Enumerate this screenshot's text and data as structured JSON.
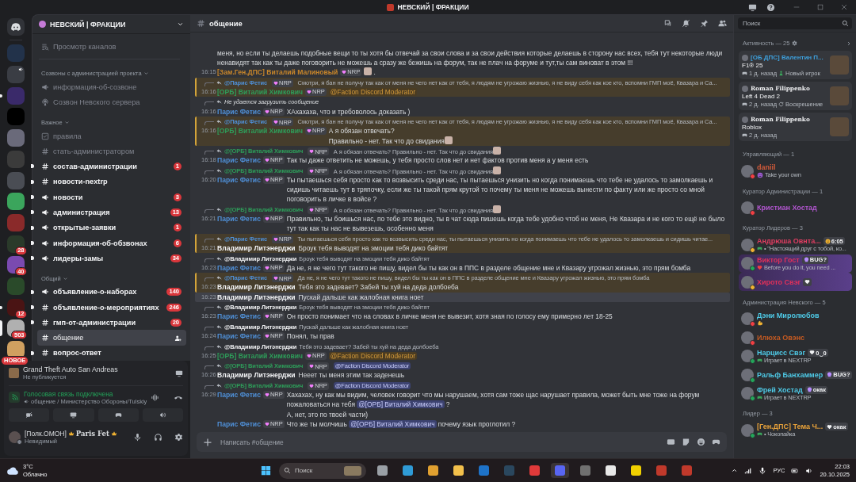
{
  "window": {
    "title": "НЕВСКИЙ | ФРАКЦИИ"
  },
  "servers": [
    {
      "selected": false,
      "unread": false,
      "in_voice": false
    },
    {
      "selected": false,
      "unread": false,
      "in_voice": true
    },
    {
      "selected": false,
      "unread": true,
      "in_voice": false
    },
    {
      "selected": false,
      "unread": false,
      "in_voice": false
    },
    {
      "selected": false,
      "unread": false,
      "in_voice": false
    },
    {
      "selected": false,
      "unread": false,
      "in_voice": false
    },
    {
      "selected": false,
      "unread": false,
      "in_voice": false
    },
    {
      "selected": false,
      "unread": false,
      "in_voice": false
    },
    {
      "selected": false,
      "unread": false,
      "in_voice": false
    },
    {
      "selected": false,
      "unread": false,
      "in_voice": false,
      "badge": "28"
    },
    {
      "selected": false,
      "unread": false,
      "in_voice": false,
      "badge": "40"
    },
    {
      "selected": false,
      "unread": false,
      "in_voice": false
    },
    {
      "selected": false,
      "unread": true,
      "in_voice": false,
      "badge": "12"
    },
    {
      "selected": true,
      "unread": false,
      "in_voice": false,
      "badge": "503"
    },
    {
      "selected": false,
      "unread": false,
      "in_voice": false,
      "badge": "НОВОЕ"
    }
  ],
  "guild": {
    "name": "НЕВСКИЙ | ФРАКЦИИ",
    "browse_label": "Просмотр каналов",
    "categories": [
      {
        "name": "Созвоны с администрацией проекта",
        "channels": [
          {
            "name": "информация-об-созвоне",
            "kind": "announcement",
            "unread": false,
            "selected": false
          },
          {
            "name": "Созвон Невского сервера",
            "kind": "stage",
            "unread": false,
            "selected": false
          }
        ]
      },
      {
        "name": "Важное",
        "channels": [
          {
            "name": "правила",
            "kind": "rules",
            "unread": false,
            "selected": false
          },
          {
            "name": "стать-администратором",
            "kind": "text",
            "unread": false,
            "selected": false
          },
          {
            "name": "состав-администрации",
            "kind": "text",
            "unread": true,
            "selected": false,
            "badge": "1"
          },
          {
            "name": "новости-nextrp",
            "kind": "text",
            "unread": true,
            "selected": false
          },
          {
            "name": "новости",
            "kind": "announcement",
            "unread": true,
            "selected": false,
            "badge": "3"
          },
          {
            "name": "администрация",
            "kind": "announcement",
            "unread": true,
            "selected": false,
            "badge": "13"
          },
          {
            "name": "открытые-заявки",
            "kind": "announcement",
            "unread": true,
            "selected": false,
            "badge": "1"
          },
          {
            "name": "информация-об-обзвонах",
            "kind": "announcement",
            "unread": true,
            "selected": false,
            "badge": "6"
          },
          {
            "name": "лидеры-замы",
            "kind": "announcement",
            "unread": true,
            "selected": false,
            "badge": "34"
          }
        ]
      },
      {
        "name": "Общий",
        "channels": [
          {
            "name": "объявление-о-наборах",
            "kind": "announcement",
            "unread": true,
            "selected": false,
            "badge": "140"
          },
          {
            "name": "объявление-о-мероприятиях",
            "kind": "text",
            "unread": true,
            "selected": false,
            "badge": "246"
          },
          {
            "name": "гмп-от-администрации",
            "kind": "text",
            "unread": true,
            "selected": false,
            "badge": "20"
          },
          {
            "name": "общение",
            "kind": "text",
            "unread": false,
            "selected": true
          },
          {
            "name": "вопрос-ответ",
            "kind": "text",
            "unread": true,
            "selected": false
          }
        ]
      }
    ]
  },
  "user_panel": {
    "activity": {
      "game": "Grand Theft Auto San Andreas",
      "status": "Не публикуется"
    },
    "voice": {
      "title": "Голосовая связь подключена",
      "channel": "общение / Министерство Обороны/Tulskiy"
    },
    "user": {
      "prefix": "[Полк.ОМОН]",
      "name": "Paris Fet",
      "status_text": "Невидимый",
      "status": {
        "color": "#80848e"
      }
    }
  },
  "chat": {
    "channel": "общение",
    "placeholder": "Написать #общение",
    "messages": [
      {
        "mentioned": false,
        "hovered": false,
        "content": [
          {
            "kind": "text",
            "text": "меня, но если ты делаешь подобные вещи то ты хотя бы отвечай за свои слова и за свои действия которые делаешь в сторону нас всех, тебя тут некоторые люди ненавидят так как ты даже поговорить не можешь а сразу же бежишь на форум, так не плач на форуме и тут,ты сам виноват в этом !!!"
          }
        ]
      },
      {
        "mentioned": false,
        "hovered": false,
        "time": "16:15",
        "author": "[Зам.Ген.ДПС] Виталий Малиновый",
        "color": "#c8862a",
        "badge": "NRP",
        "content": [
          {
            "kind": "emoji"
          },
          {
            "kind": "text",
            "text": " ."
          }
        ]
      },
      {
        "mentioned": true,
        "hovered": false,
        "reply": {
          "kind": "message",
          "author": "@Парис Фетис",
          "color": "#4f8fd6",
          "badge": "NRP",
          "content": [
            {
              "kind": "text",
              "text": "Смотри, я бан не получу так как от меня не чего нет как от тебя, я людям не угрожаю жизнью, я не виду себя как кое кто, вспомни ГМП моё, Квазара и Са..."
            }
          ]
        },
        "time": "16:16",
        "author": "[ОРБ] Виталий Химкович",
        "color": "#2e9e5a",
        "badge": "NRP",
        "content": [
          {
            "kind": "role_mention",
            "text": "@Faction Discord Moderator"
          }
        ]
      },
      {
        "mentioned": false,
        "hovered": false,
        "reply": {
          "kind": "missing",
          "content": [
            {
              "kind": "text",
              "text": "Не удается загрузить сообщение"
            }
          ]
        },
        "time": "16:16",
        "author": "Парис Фетис",
        "color": "#4f8fd6",
        "badge": "NRP",
        "content": [
          {
            "kind": "text",
            "text": "ХАхахаха, что и требоволось доказать )"
          }
        ]
      },
      {
        "mentioned": true,
        "hovered": false,
        "reply": {
          "kind": "message",
          "author": "@Парис Фетис",
          "color": "#4f8fd6",
          "badge": "NRP",
          "content": [
            {
              "kind": "text",
              "text": "Смотри, я бан не получу так как от меня не чего нет как от тебя, я людям не угрожаю жизнью, я не виду себя как кое кто, вспомни ГМП моё, Квазара и Са..."
            }
          ]
        },
        "time": "16:16",
        "author": "[ОРБ] Виталий Химкович",
        "color": "#2e9e5a",
        "badge": "NRP",
        "content": [
          {
            "kind": "text",
            "text": "А я обязан отвечать?"
          },
          {
            "kind": "break"
          },
          {
            "kind": "text",
            "text": "Правильно - нет. Так что до свидания"
          },
          {
            "kind": "emoji"
          }
        ]
      },
      {
        "mentioned": false,
        "hovered": false,
        "reply": {
          "kind": "message",
          "author": "@[ОРБ] Виталий Химкович",
          "color": "#2e9e5a",
          "badge": "NRP",
          "content": [
            {
              "kind": "text",
              "text": "А я обязан отвечать? Правильно - нет. Так что до свидания"
            },
            {
              "kind": "emoji"
            }
          ]
        },
        "time": "16:18",
        "author": "Парис Фетис",
        "color": "#4f8fd6",
        "badge": "NRP",
        "content": [
          {
            "kind": "text",
            "text": "Так ты даже ответить не можешь, у тебя просто слов нет и нет фактов против меня а у меня есть"
          }
        ]
      },
      {
        "mentioned": false,
        "hovered": false,
        "reply": {
          "kind": "message",
          "author": "@[ОРБ] Виталий Химкович",
          "color": "#2e9e5a",
          "badge": "NRP",
          "content": [
            {
              "kind": "text",
              "text": "А я обязан отвечать? Правильно - нет. Так что до свидания"
            },
            {
              "kind": "emoji"
            }
          ]
        },
        "time": "16:20",
        "author": "Парис Фетис",
        "color": "#4f8fd6",
        "badge": "NRP",
        "content": [
          {
            "kind": "text",
            "text": "Ты пытаешься себя просто как то возвысить среди нас, ты пытаешься унизить но когда понимаешь что тебе не удалось то замолкаешь и сидишь читаешь тут в тряпочку, если же ты такой прям крутой то почему ты меня не можешь вынести по факту или же просто со мной поговорить в личке в войсе ?"
          }
        ]
      },
      {
        "mentioned": false,
        "hovered": false,
        "reply": {
          "kind": "message",
          "author": "@[ОРБ] Виталий Химкович",
          "color": "#2e9e5a",
          "badge": "NRP",
          "content": [
            {
              "kind": "text",
              "text": "А я обязан отвечать? Правильно - нет. Так что до свидания"
            },
            {
              "kind": "emoji"
            }
          ]
        },
        "time": "16:21",
        "author": "Парис Фетис",
        "color": "#4f8fd6",
        "badge": "NRP",
        "content": [
          {
            "kind": "text",
            "text": "Правильно, ты боишься нас, по тебе это видно, ты в чат сюда пишешь когда тебе удобно чтоб не меня, Не Квазара и не кого то ещё не было тут так как ты нас не вывезешь, особенно меня"
          }
        ]
      },
      {
        "mentioned": true,
        "hovered": false,
        "reply": {
          "kind": "message",
          "author": "@Парис Фетис",
          "color": "#4f8fd6",
          "badge": "NRP",
          "content": [
            {
              "kind": "text",
              "text": "Ты пытаешься себя просто как то возвысить среди нас, ты пытаешься унизить но когда понимаешь что тебе не удалось то замолкаешь и сидишь читае..."
            }
          ]
        },
        "time": "16:21",
        "author": "Владимир Литэнерджи",
        "color": "#f2f3f5",
        "content": [
          {
            "kind": "text",
            "text": "Броук тебя выводят на эмоции тебя дико байтят"
          }
        ]
      },
      {
        "mentioned": false,
        "hovered": false,
        "reply": {
          "kind": "message",
          "author": "@Владимир Литэнерджи",
          "color": "#f2f3f5",
          "content": [
            {
              "kind": "text",
              "text": "Броук тебя выводят на эмоции тебя дико байтят"
            }
          ]
        },
        "time": "16:23",
        "author": "Парис Фетис",
        "color": "#4f8fd6",
        "badge": "NRP",
        "content": [
          {
            "kind": "text",
            "text": "Да не, я не чего тут такого не пишу, видел бы ты как он в ППС в разделе общение мне и Квазару угрожал жизнью, это прям бомба"
          }
        ]
      },
      {
        "mentioned": true,
        "hovered": false,
        "reply": {
          "kind": "message",
          "author": "@Парис Фетис",
          "color": "#4f8fd6",
          "badge": "NRP",
          "content": [
            {
              "kind": "text",
              "text": "Да не, я не чего тут такого не пишу, видел бы ты как он в ППС в разделе общение мне и Квазару угрожал жизнью, это прям бомба"
            }
          ]
        },
        "time": "16:23",
        "author": "Владимир Литэнерджи",
        "color": "#f2f3f5",
        "content": [
          {
            "kind": "text",
            "text": "Тебя это задевает? Забей ты хуй на деда долбоеба"
          }
        ]
      },
      {
        "mentioned": false,
        "hovered": true,
        "time": "16:23",
        "author": "Владимир Литэнерджи",
        "color": "#f2f3f5",
        "content": [
          {
            "kind": "text",
            "text": "Пускай дальше как жалобная книга ноет"
          }
        ]
      },
      {
        "mentioned": false,
        "hovered": false,
        "reply": {
          "kind": "message",
          "author": "@Владимир Литэнерджи",
          "color": "#f2f3f5",
          "content": [
            {
              "kind": "text",
              "text": "Броук тебя выводят на эмоции тебя дико байтят"
            }
          ]
        },
        "time": "16:23",
        "author": "Парис Фетис",
        "color": "#4f8fd6",
        "badge": "NRP",
        "content": [
          {
            "kind": "text",
            "text": "Он просто понимает что на словах в личке меня не вывезит, хотя зная по голосу ему примерно лет 18-25"
          }
        ]
      },
      {
        "mentioned": false,
        "hovered": false,
        "reply": {
          "kind": "message",
          "author": "@Владимир Литэнерджи",
          "color": "#f2f3f5",
          "content": [
            {
              "kind": "text",
              "text": "Пускай дальше как жалобная книга ноет"
            }
          ]
        },
        "time": "16:24",
        "author": "Парис Фетис",
        "color": "#4f8fd6",
        "badge": "NRP",
        "content": [
          {
            "kind": "text",
            "text": "Понял, ты прав"
          }
        ]
      },
      {
        "mentioned": false,
        "hovered": false,
        "reply": {
          "kind": "message",
          "author": "@Владимир Литэнерджи",
          "color": "#f2f3f5",
          "content": [
            {
              "kind": "text",
              "text": "Тебя это задевает? Забей ты хуй на деда долбоеба"
            }
          ]
        },
        "time": "16:25",
        "author": "[ОРБ] Виталий Химкович",
        "color": "#2e9e5a",
        "badge": "NRP",
        "content": [
          {
            "kind": "role_mention",
            "text": "@Faction Discord Moderator"
          }
        ]
      },
      {
        "mentioned": false,
        "hovered": false,
        "reply": {
          "kind": "message",
          "author": "@[ОРБ] Виталий Химкович",
          "color": "#2e9e5a",
          "badge": "NRP",
          "content": [
            {
              "kind": "mention",
              "text": "@Faction Discord Moderator"
            }
          ]
        },
        "time": "16:26",
        "author": "Владимир Литэнерджи",
        "color": "#f2f3f5",
        "content": [
          {
            "kind": "text",
            "text": "Нееет ты меня этим так заденешь"
          }
        ]
      },
      {
        "mentioned": false,
        "hovered": false,
        "reply": {
          "kind": "message",
          "author": "@[ОРБ] Виталий Химкович",
          "color": "#2e9e5a",
          "badge": "NRP",
          "content": [
            {
              "kind": "mention",
              "text": "@Faction Discord Moderator"
            }
          ]
        },
        "time": "16:29",
        "author": "Парис Фетис",
        "color": "#4f8fd6",
        "badge": "NRP",
        "content": [
          {
            "kind": "text",
            "text": "Хахахах, ну как мы видим, человек говорит что мы нарушаем, хотя сам тоже щас нарушает правила, может быть мне тоже на форум пожаловаться на тебя "
          },
          {
            "kind": "mention",
            "text": "@[ОРБ] Виталий Химкович"
          },
          {
            "kind": "text",
            "text": " ?"
          },
          {
            "kind": "break"
          },
          {
            "kind": "text",
            "text": "А, нет, это по твоей части)"
          }
        ]
      },
      {
        "mentioned": false,
        "hovered": false,
        "author": "Парис Фетис",
        "color": "#4f8fd6",
        "badge": "NRP",
        "content": [
          {
            "kind": "text",
            "text": "Что же ты молчишь "
          },
          {
            "kind": "mention",
            "text": "@[ОРБ] Виталий Химкович"
          },
          {
            "kind": "text",
            "text": " почему язык проглотил ?"
          }
        ]
      }
    ]
  },
  "member_list": {
    "search_placeholder": "Поиск",
    "activity": {
      "title": "Активность — 25",
      "cards": [
        {
          "user": "[ОБ ДПС] Валентин П...",
          "color": "#3ea0dc",
          "fancy": false,
          "game": "F1® 25",
          "ago": "1 д. назад",
          "detail": {
            "kind": "player",
            "text": "Новый игрок"
          }
        },
        {
          "user": "Roman Filippenko",
          "color": "#f2f3f5",
          "fancy": true,
          "game": "Left 4 Dead 2",
          "ago": "2 д. назад",
          "detail": {
            "kind": "refresh",
            "text": "Воскрешение"
          }
        },
        {
          "user": "Roman Filippenko",
          "color": "#f2f3f5",
          "fancy": true,
          "game": "Roblox",
          "ago": "2 д. назад"
        }
      ]
    },
    "groups": [
      {
        "title": "Управляющий — 1",
        "members": [
          {
            "name": "daniil",
            "color": "#d05a3a",
            "status": {
              "color": "#f23f43"
            },
            "banner": false,
            "sub": {
              "kind": "emoji",
              "text": "Take your own"
            }
          }
        ]
      },
      {
        "title": "Куратор Администрации — 1",
        "members": [
          {
            "name": "Кристиан Хостад",
            "color": "#b256d0",
            "status": {
              "color": "#f23f43"
            },
            "banner": false
          }
        ]
      },
      {
        "title": "Куратор Лидеров — 3",
        "members": [
          {
            "name": "Андрюша Овнта...",
            "color": "#e23d62",
            "status": {
              "color": "#f0b232"
            },
            "banner": false,
            "tag": {
              "kind": "face",
              "text": "6:05"
            },
            "sub": {
              "kind": "gamepad",
              "text": "• \"Настоящий друг с тобой, ко..."
            }
          },
          {
            "name": "Виктор Гост",
            "color": "#e0305a",
            "status": {
              "color": "#23a55a"
            },
            "banner": true,
            "tag": {
              "kind": "skull",
              "text": "BUG?"
            },
            "sub": {
              "kind": "heart",
              "text": "Before you do it, you need ..."
            }
          },
          {
            "name": "Хирото Свэг",
            "color": "#e0305a",
            "status": {
              "color": "#f0b232"
            },
            "banner": true,
            "tag": {
              "kind": "heart"
            }
          }
        ]
      },
      {
        "title": "Администрация Невского — 5",
        "members": [
          {
            "name": "Дэни Миролюбов",
            "color": "#4ec9e6",
            "status": {
              "color": "#f23f43"
            },
            "banner": false,
            "sub": {
              "kind": "muscle"
            }
          },
          {
            "name": "Илюха Овэнс",
            "color": "#c45a22",
            "status": {
              "color": "#f23f43"
            },
            "banner": false
          },
          {
            "name": "Нарцисс Свэг",
            "color": "#4ec9e6",
            "status": {
              "color": "#23a55a"
            },
            "banner": false,
            "tag": {
              "kind": "heart",
              "text": "0‿0"
            },
            "sub": {
              "kind": "gamepad",
              "text": "Играет в NEXTRP"
            }
          },
          {
            "name": "Ральф Банхаммер",
            "color": "#4ec9e6",
            "status": {
              "color": "#23a55a"
            },
            "banner": false,
            "tag": {
              "kind": "skull",
              "text": "BUG?"
            }
          },
          {
            "name": "Фрей Хостад",
            "color": "#4ec9e6",
            "status": {
              "color": "#23a55a"
            },
            "banner": false,
            "tag": {
              "kind": "skull",
              "text": "окак"
            },
            "sub": {
              "kind": "gamepad",
              "text": "Играет в NEXTRP"
            }
          }
        ]
      },
      {
        "title": "Лидер — 3",
        "members": [
          {
            "name": "[Ген.ДПС] Тема Ч...",
            "color": "#e8a23a",
            "status": {
              "color": "#23a55a"
            },
            "banner": false,
            "tag": {
              "kind": "heart",
              "text": "окак"
            },
            "sub": {
              "kind": "gamepad",
              "text": "• Чокопайка"
            }
          }
        ]
      }
    ]
  },
  "taskbar": {
    "weather": {
      "temp": "3°C",
      "condition": "Облачно"
    },
    "search_placeholder": "Поиск",
    "apps": [
      {
        "kind": "files",
        "active": false
      },
      {
        "kind": "globe",
        "active": false
      },
      {
        "kind": "bag",
        "active": false
      },
      {
        "kind": "folder",
        "active": false
      },
      {
        "kind": "mail",
        "active": false
      },
      {
        "kind": "disc",
        "active": false
      },
      {
        "kind": "ring",
        "active": false
      },
      {
        "kind": "chat",
        "active": true
      },
      {
        "kind": "aperture",
        "active": false
      },
      {
        "kind": "square",
        "active": false
      },
      {
        "kind": "lock",
        "active": false
      },
      {
        "kind": "n",
        "active": false
      },
      {
        "kind": "n",
        "active": false
      }
    ],
    "language": "РУС",
    "time": "22:03",
    "date": "20.10.2025"
  }
}
